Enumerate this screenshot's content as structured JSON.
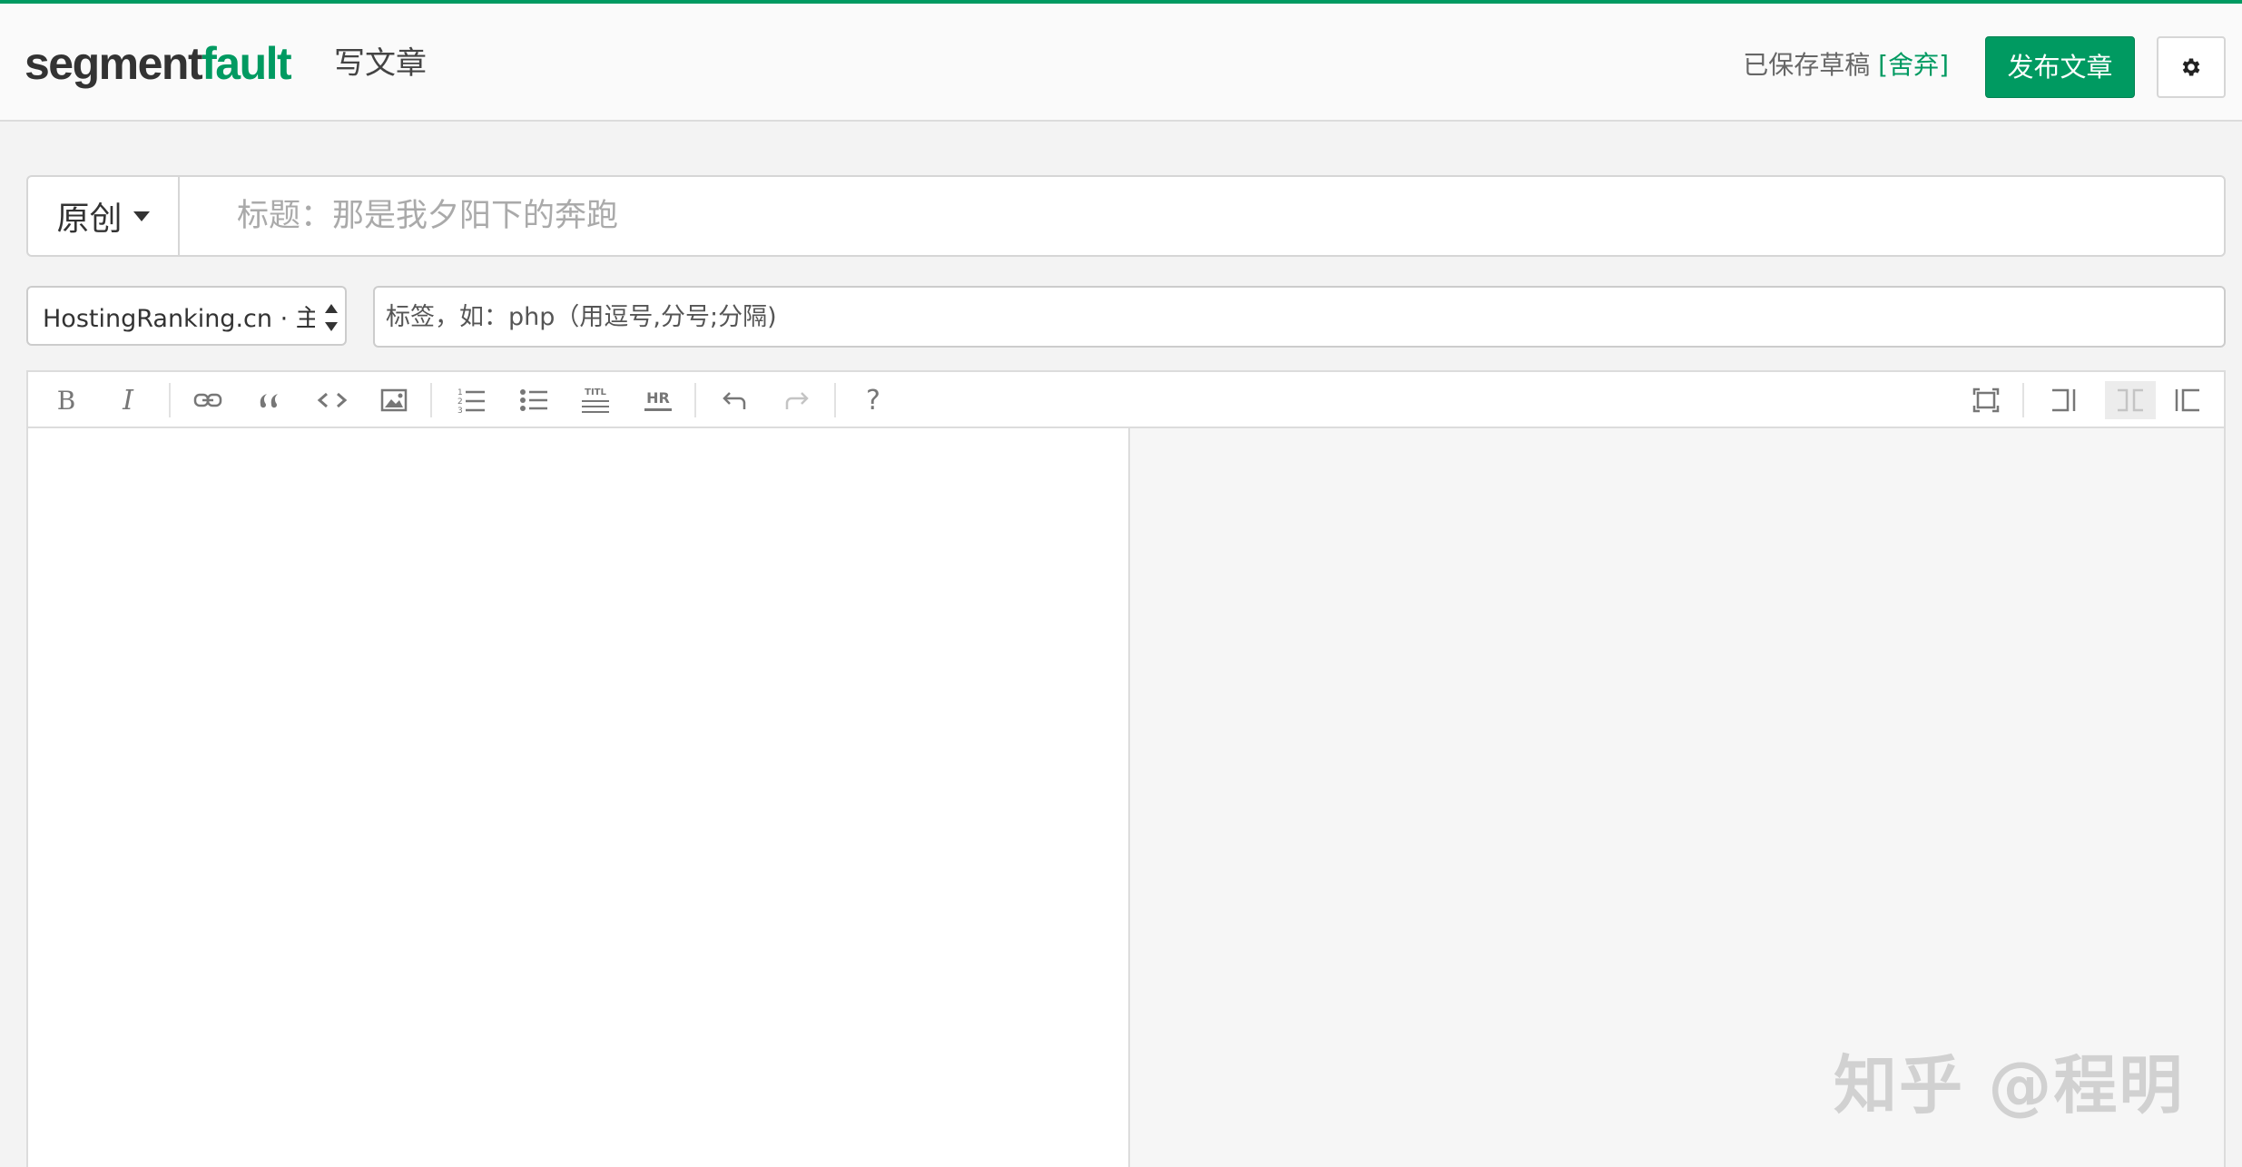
{
  "header": {
    "logo_part1": "segment",
    "logo_part2": "fault",
    "page_name": "写文章",
    "saved_text": "已保存草稿",
    "discard_label": "[舍弃]",
    "publish_label": "发布文章",
    "settings_icon": "gear-icon"
  },
  "title_row": {
    "type_label": "原创",
    "title_placeholder": "标题：那是我夕阳下的奔跑"
  },
  "meta_row": {
    "column_selected": "HostingRanking.cn · 主机",
    "tags_placeholder": "标签，如：php（用逗号,分号;分隔)"
  },
  "toolbar": {
    "bold": "B",
    "italic": "I",
    "title_icon_text": "TITL",
    "hr_text": "HR",
    "help": "?",
    "left_icons": [
      "bold-icon",
      "italic-icon",
      "link-icon",
      "quote-icon",
      "code-icon",
      "image-icon",
      "ordered-list-icon",
      "unordered-list-icon",
      "heading-icon",
      "hr-icon",
      "undo-icon",
      "redo-icon",
      "help-icon"
    ],
    "right_icons": [
      "fullscreen-icon",
      "edit-only-icon",
      "split-view-icon",
      "preview-only-icon"
    ]
  },
  "watermark": "知乎 @程明",
  "colors": {
    "brand": "#009a61",
    "background": "#f3f3f3"
  }
}
